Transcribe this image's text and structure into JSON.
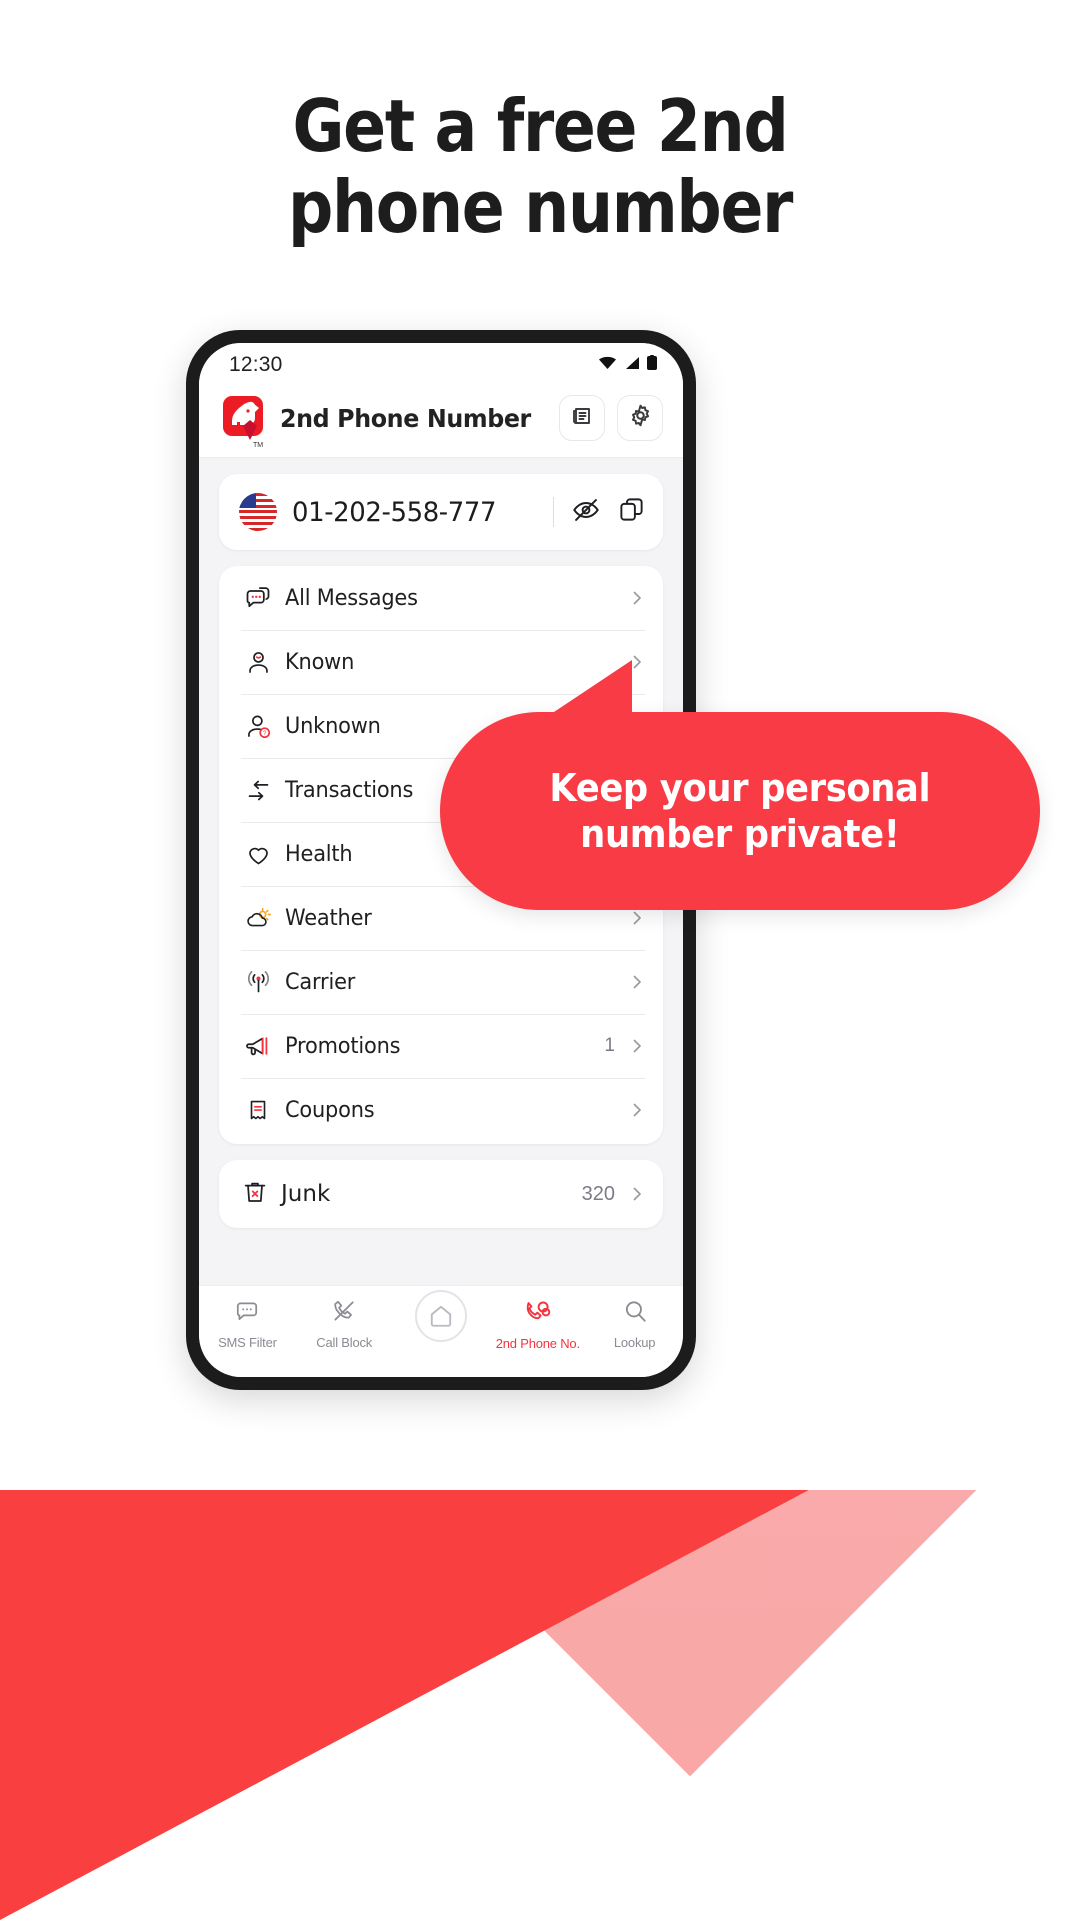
{
  "headline": "Get a free 2nd\nphone number",
  "headline_line1": "Get a free 2nd",
  "headline_line2": "phone number",
  "phone": {
    "status_bar": {
      "time": "12:30",
      "icons": [
        "wifi-icon",
        "signal-icon",
        "battery-icon"
      ]
    },
    "app_header": {
      "logo": "hound-check-logo",
      "trademark": "TM",
      "title": "2nd Phone Number",
      "actions": [
        {
          "name": "news-icon",
          "label": "News"
        },
        {
          "name": "gear-icon",
          "label": "Settings"
        }
      ]
    },
    "number_card": {
      "flag": "us-flag-icon",
      "number": "01-202-558-777",
      "hide_icon": "eye-off-icon",
      "copy_icon": "copy-icon"
    },
    "menu": [
      {
        "icon": "chat-bubbles-icon",
        "label": "All Messages",
        "badge": "",
        "chevron": true
      },
      {
        "icon": "person-smile-icon",
        "label": "Known",
        "badge": "",
        "chevron": true
      },
      {
        "icon": "person-question-icon",
        "label": "Unknown",
        "badge": "",
        "chevron": true
      },
      {
        "icon": "transfer-arrows-icon",
        "label": "Transactions",
        "badge": "",
        "chevron": true
      },
      {
        "icon": "heart-icon",
        "label": "Health",
        "badge": "",
        "chevron": true
      },
      {
        "icon": "weather-icon",
        "label": "Weather",
        "badge": "",
        "chevron": true
      },
      {
        "icon": "carrier-signal-icon",
        "label": "Carrier",
        "badge": "",
        "chevron": true
      },
      {
        "icon": "megaphone-icon",
        "label": "Promotions",
        "badge": "1",
        "chevron": true
      },
      {
        "icon": "coupon-icon",
        "label": "Coupons",
        "badge": "",
        "chevron": true
      }
    ],
    "junk": {
      "icon": "trash-x-icon",
      "label": "Junk",
      "count": "320"
    },
    "tabbar": [
      {
        "icon": "sms-filter-icon",
        "label": "SMS Filter",
        "active": false
      },
      {
        "icon": "call-block-icon",
        "label": "Call Block",
        "active": false
      },
      {
        "icon": "home-icon",
        "label": "",
        "active": false
      },
      {
        "icon": "second-phone-icon",
        "label": "2nd Phone No.",
        "active": true
      },
      {
        "icon": "lookup-icon",
        "label": "Lookup",
        "active": false
      }
    ]
  },
  "callout": {
    "line1": "Keep your personal",
    "line2": "number private!"
  },
  "colors": {
    "brand_red": "#f93b45",
    "logo_red": "#ed1c24",
    "accent_light": "#fbb3b3",
    "text_dark": "#1d1d1d",
    "muted": "#8b8b93"
  }
}
